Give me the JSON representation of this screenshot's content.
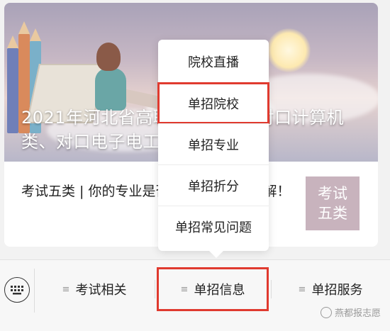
{
  "article": {
    "title": "2021年河北省高职单招五类、对口计算机类、对口电子电工类录取档表",
    "summary": "考试五类 | 你的专业是否被录取？一文详解！",
    "tag": "考试\n五类"
  },
  "popup_menu": {
    "items": [
      {
        "label": "院校直播"
      },
      {
        "label": "单招院校"
      },
      {
        "label": "单招专业"
      },
      {
        "label": "单招折分"
      },
      {
        "label": "单招常见问题"
      }
    ]
  },
  "bottom_menu": {
    "tabs": [
      {
        "label": "考试相关"
      },
      {
        "label": "单招信息"
      },
      {
        "label": "单招服务"
      }
    ]
  },
  "watermark": {
    "text": "燕都报志愿"
  },
  "colors": {
    "highlight": "#e03a2f",
    "tag_bg": "#c8b3bd"
  }
}
